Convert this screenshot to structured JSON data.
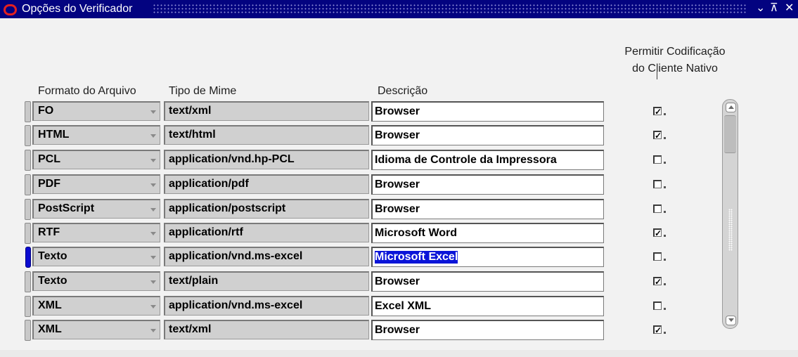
{
  "window": {
    "title": "Opções do Verificador",
    "buttons": {
      "minimize": "⌄",
      "maximize": "⊼",
      "close": "✕"
    }
  },
  "headers": {
    "format": "Formato do Arquivo",
    "mime": "Tipo de Mime",
    "description": "Descrição",
    "native_line1": "Permitir Codificação",
    "native_line2": "do Cliente Nativo"
  },
  "rows": [
    {
      "format": "FO",
      "mime": "text/xml",
      "description": "Browser",
      "native": true,
      "current": false
    },
    {
      "format": "HTML",
      "mime": "text/html",
      "description": "Browser",
      "native": true,
      "current": false
    },
    {
      "format": "PCL",
      "mime": "application/vnd.hp-PCL",
      "description": "Idioma de Controle da Impressora",
      "native": false,
      "current": false
    },
    {
      "format": "PDF",
      "mime": "application/pdf",
      "description": "Browser",
      "native": false,
      "current": false
    },
    {
      "format": "PostScript",
      "mime": "application/postscript",
      "description": "Browser",
      "native": false,
      "current": false
    },
    {
      "format": "RTF",
      "mime": "application/rtf",
      "description": "Microsoft Word",
      "native": true,
      "current": false
    },
    {
      "format": "Texto",
      "mime": "application/vnd.ms-excel",
      "description": "Microsoft Excel",
      "native": false,
      "current": true
    },
    {
      "format": "Texto",
      "mime": "text/plain",
      "description": "Browser",
      "native": true,
      "current": false
    },
    {
      "format": "XML",
      "mime": "application/vnd.ms-excel",
      "description": "Excel XML",
      "native": false,
      "current": false
    },
    {
      "format": "XML",
      "mime": "text/xml",
      "description": "Browser",
      "native": true,
      "current": false
    }
  ],
  "colors": {
    "titlebar": "#030380",
    "selection": "#0a14d8",
    "current_row": "#0b0bd0"
  },
  "icons": {
    "logo": "oracle-logo-icon",
    "dropdown": "chevron-down-icon"
  }
}
